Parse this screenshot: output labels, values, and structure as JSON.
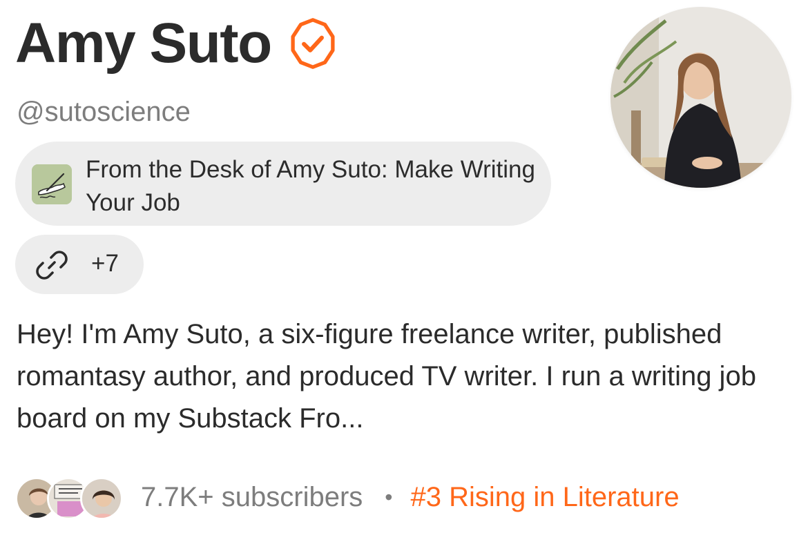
{
  "profile": {
    "name": "Amy Suto",
    "handle": "@sutoscience",
    "verified_color": "#ff6719"
  },
  "publication": {
    "title": "From the Desk of Amy Suto: Make Writing Your Job",
    "logo_icon": "hand-writing-icon"
  },
  "links": {
    "icon": "link-icon",
    "count": "+7"
  },
  "bio": "Hey! I'm Amy Suto, a six-figure freelance writer, published romantasy author, and produced TV writer. I run a writing job board on my Substack Fro...",
  "stats": {
    "subscribers": "7.7K+ subscribers",
    "separator": "•",
    "rank": "#3 Rising in Literature",
    "rank_color": "#ff6719"
  }
}
